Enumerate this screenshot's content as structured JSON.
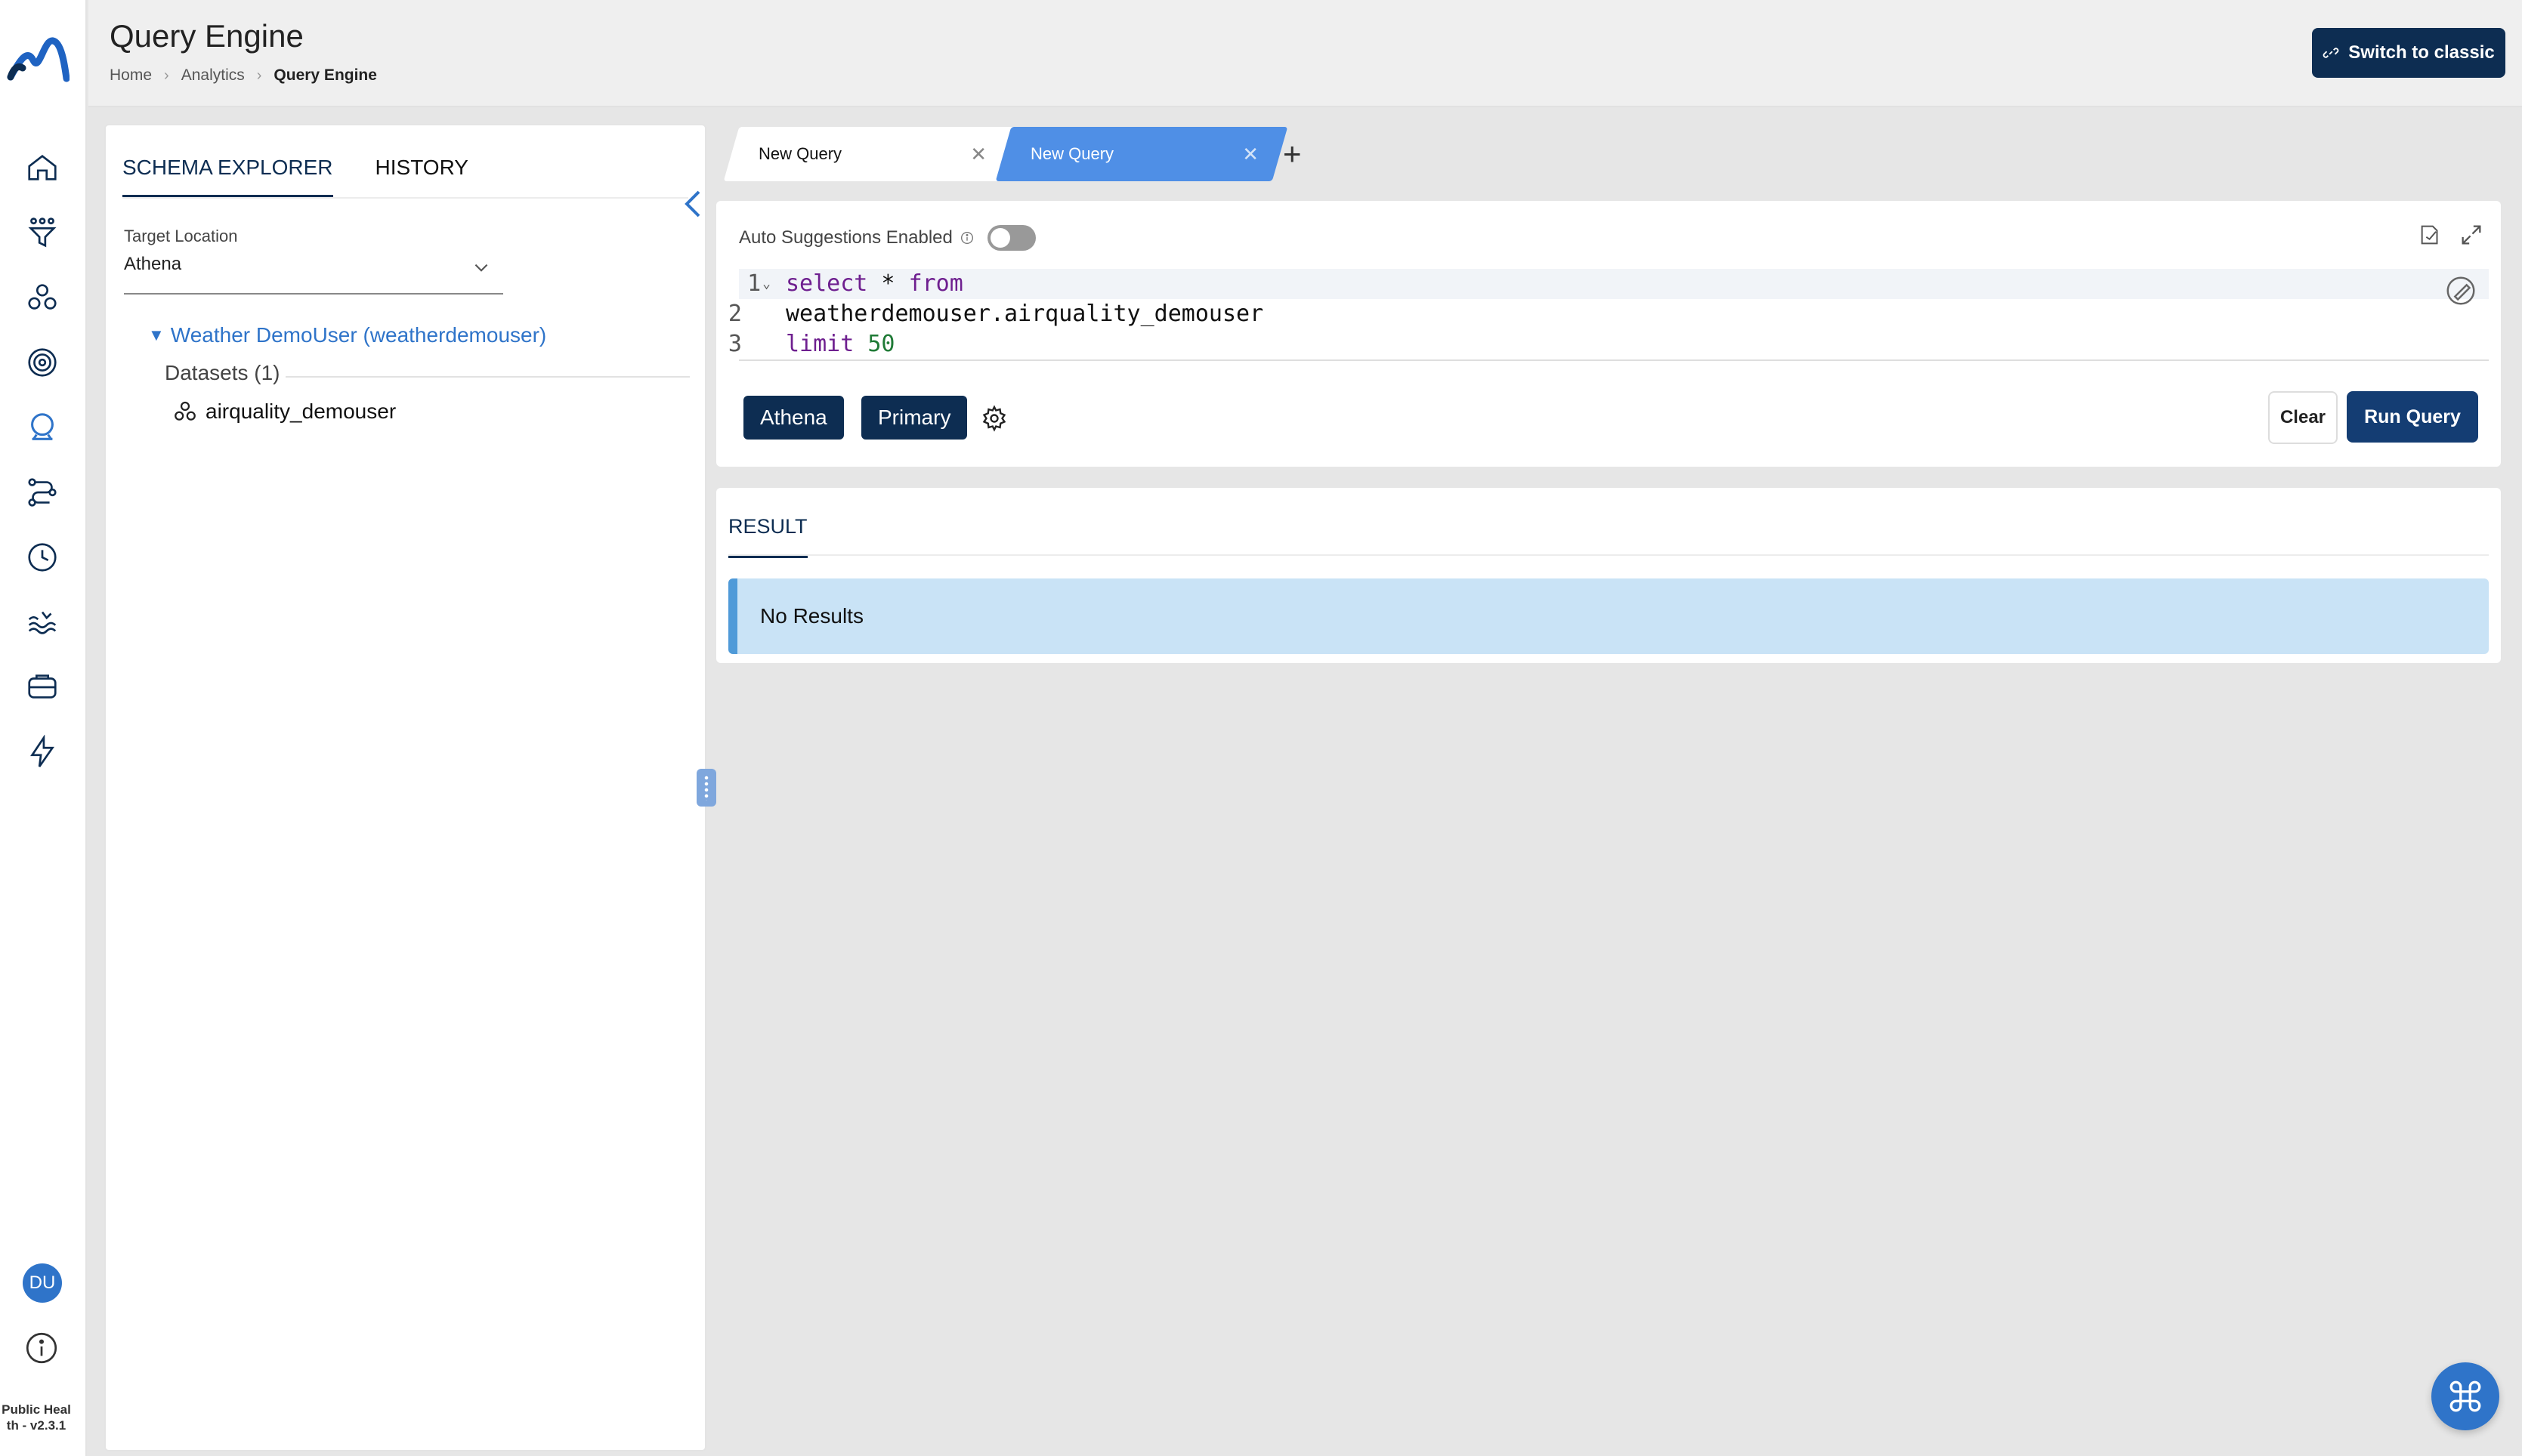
{
  "header": {
    "title": "Query Engine",
    "breadcrumb": [
      "Home",
      "Analytics",
      "Query Engine"
    ],
    "switch_label": "Switch to classic"
  },
  "rail": {
    "nav_icons": [
      "home-icon",
      "funnel-icon",
      "datasets-icon",
      "target-icon",
      "query-engine-icon",
      "workflow-icon",
      "clock-icon",
      "data-lake-icon",
      "storage-icon",
      "lightning-icon"
    ],
    "avatar": "DU",
    "version": "Public Heal th - v2.3.1"
  },
  "schema": {
    "tabs": [
      "SCHEMA EXPLORER",
      "HISTORY"
    ],
    "target_label": "Target Location",
    "target_value": "Athena",
    "tree_root": "Weather DemoUser (weatherdemouser)",
    "datasets_label": "Datasets (1)",
    "dataset": "airquality_demouser"
  },
  "query_tabs": [
    "New Query",
    "New Query"
  ],
  "editor": {
    "auto_suggestions_label": "Auto Suggestions Enabled",
    "auto_suggestions_on": false,
    "lines": [
      {
        "num": "1",
        "kw1": "select",
        "mid": " * ",
        "kw2": "from"
      },
      {
        "num": "2",
        "text": "weatherdemouser.airquality_demouser"
      },
      {
        "num": "3",
        "kw": "limit",
        "val": "50"
      }
    ],
    "engine_badge": "Athena",
    "workgroup_badge": "Primary",
    "clear_label": "Clear",
    "run_label": "Run Query"
  },
  "result": {
    "tab": "RESULT",
    "message": "No Results"
  },
  "colors": {
    "primary": "#0d2d52",
    "accent": "#2f74c9",
    "active_tab": "#4f8fe6",
    "no_results_bg": "#c9e3f6"
  }
}
